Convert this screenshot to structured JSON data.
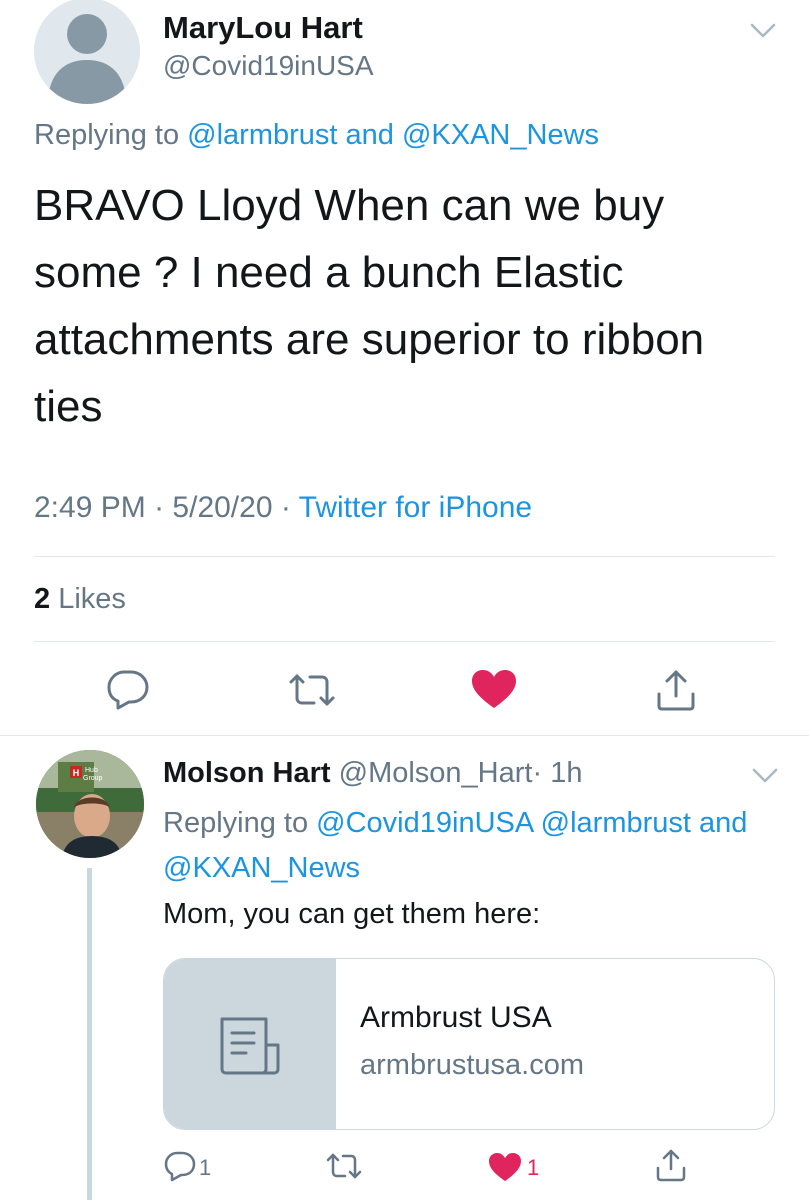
{
  "main_tweet": {
    "display_name": "MaryLou Hart",
    "handle": "@Covid19inUSA",
    "replying_prefix": "Replying to",
    "replying_user1": "@larmbrust",
    "replying_and": "and",
    "replying_user2": "@KXAN_News",
    "body": "BRAVO Lloyd When can we buy some ? I need a bunch Elastic attachments are superior to ribbon ties",
    "time": "2:49 PM",
    "date": "5/20/20",
    "separator": "·",
    "source": "Twitter for iPhone",
    "likes_count": "2",
    "likes_label": "Likes",
    "actions": [
      "reply-icon",
      "retweet-icon",
      "like-icon",
      "share-icon"
    ]
  },
  "reply_tweet": {
    "display_name": "Molson Hart",
    "handle": "@Molson_Hart",
    "separator": "·",
    "time": "1h",
    "replying_prefix": "Replying to",
    "replying_user1": "@Covid19inUSA",
    "replying_user2": "@larmbrust",
    "replying_and": "and",
    "replying_user3": "@KXAN_News",
    "text": "Mom, you can get them here:",
    "avatar_sign_text": "Hub Group",
    "card": {
      "title": "Armbrust USA",
      "domain": "armbrustusa.com",
      "icon": "document-icon"
    },
    "reply_count": "1",
    "like_count": "1"
  },
  "colors": {
    "text_primary": "#14171a",
    "text_secondary": "#657786",
    "link": "#1b95e0",
    "like_red": "#e0245e",
    "divider": "#e1e8ed",
    "thread_line": "#ccd6dd"
  }
}
